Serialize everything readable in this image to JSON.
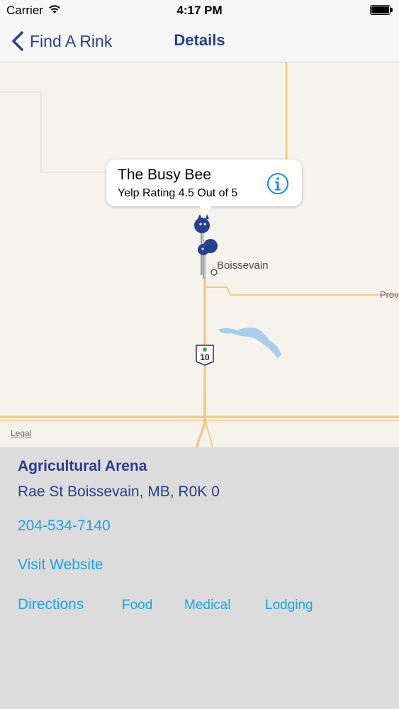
{
  "status_bar": {
    "carrier": "Carrier",
    "time": "4:17 PM"
  },
  "nav": {
    "back_label": "Find A Rink",
    "title": "Details"
  },
  "map": {
    "callout": {
      "title": "The Busy Bee",
      "subtitle": "Yelp Rating 4.5 Out of 5"
    },
    "town_label": "Boissevain",
    "road_label": "Prov",
    "highway_number": "10",
    "legal_label": "Legal",
    "colors": {
      "road": "#f3c989",
      "water": "#a9cdee",
      "land": "#f6f3ec",
      "pin": "#25408f"
    }
  },
  "details": {
    "name": "Agricultural Arena",
    "address": "Rae St Boissevain, MB, R0K 0",
    "phone": "204-534-7140",
    "website_label": "Visit Website",
    "links": {
      "directions": "Directions",
      "food": "Food",
      "medical": "Medical",
      "lodging": "Lodging"
    }
  },
  "colors": {
    "nav_blue": "#25408f",
    "link_blue": "#1aa3e8",
    "detail_bg": "#dcdcdc"
  }
}
